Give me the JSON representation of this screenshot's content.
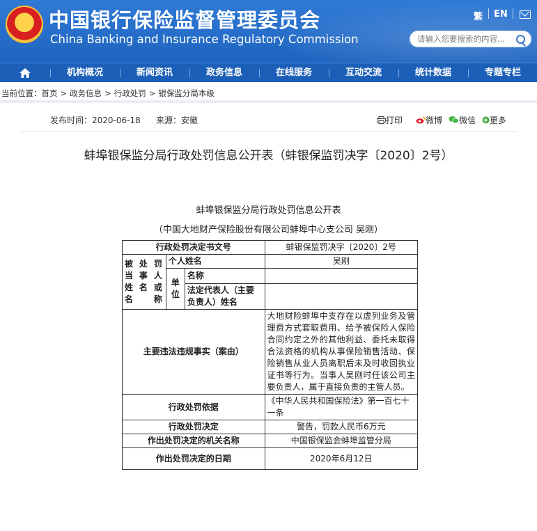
{
  "header": {
    "title_cn": "中国银行保险监督管理委员会",
    "title_en": "China Banking and Insurance Regulatory Commission",
    "lang_traditional": "繁",
    "lang_english": "EN",
    "search_placeholder": "请输入您要搜索的内容...",
    "brand_color": "#1f64bf"
  },
  "nav": {
    "items": [
      "机构概况",
      "新闻资讯",
      "政务信息",
      "在线服务",
      "互动交流",
      "统计数据",
      "专题专栏"
    ]
  },
  "breadcrumb": {
    "label": "当前位置：",
    "items": [
      "首页",
      "政务信息",
      "行政处罚",
      "银保监分局本级"
    ],
    "separator": ">"
  },
  "meta": {
    "publish_time": "发布时间：2020-06-18",
    "source": "来源：安徽",
    "share": {
      "print": "打印",
      "weibo": "微博",
      "wechat": "微信",
      "more": "更多"
    }
  },
  "article": {
    "title": "蚌埠银保监分局行政处罚信息公开表（蚌银保监罚决字〔2020〕2号）",
    "table_title": "蚌埠银保监分局行政处罚信息公开表",
    "table_subtitle": "（中国大地财产保险股份有限公司蚌埠中心支公司  吴刚）",
    "table": {
      "doc_no_label": "行政处罚决定书文号",
      "doc_no_value": "蚌银保监罚决字〔2020〕2号",
      "party_label": "被处罚当事人姓名或名称",
      "person_name_label": "个人姓名",
      "person_name_value": "吴刚",
      "unit_label": "单位",
      "unit_name_label": "名称",
      "unit_name_value": "",
      "legal_rep_label": "法定代表人（主要负责人）姓名",
      "legal_rep_value": "",
      "facts_label": "主要违法违规事实（案由）",
      "facts_value": "大地财险蚌埠中支存在以虚列业务及管理费方式套取费用、给予被保险人保险合同约定之外的其他利益、委托未取得合法资格的机构从事保险销售活动、保险销售从业人员离职后未及时收回执业证书等行为。当事人吴刚时任该公司主要负责人，属于直接负责的主管人员。",
      "basis_label": "行政处罚依据",
      "basis_value": "《中华人民共和国保险法》第一百七十一条",
      "decision_label": "行政处罚决定",
      "decision_value": "警告，罚款人民币6万元",
      "authority_label": "作出处罚决定的机关名称",
      "authority_value": "中国银保监会蚌埠监管分局",
      "date_label": "作出处罚决定的日期",
      "date_value": "2020年6月12日"
    }
  }
}
